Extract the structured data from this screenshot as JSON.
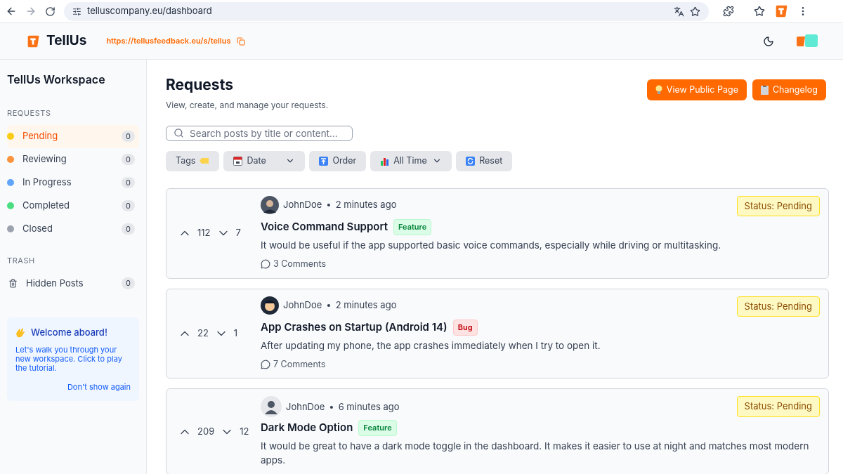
{
  "browser": {
    "url": "telluscompany.eu/dashboard"
  },
  "header": {
    "brand": "TellUs",
    "link": "https://tellusfeedback.eu/s/tellus"
  },
  "sidebar": {
    "title": "TellUs Workspace",
    "sections": [
      {
        "heading": "REQUESTS",
        "items": [
          {
            "label": "Pending",
            "count": "0",
            "color": "#facc15",
            "selected": true
          },
          {
            "label": "Reviewing",
            "count": "0",
            "color": "#fb923c",
            "selected": false
          },
          {
            "label": "In Progress",
            "count": "0",
            "color": "#60a5fa",
            "selected": false
          },
          {
            "label": "Completed",
            "count": "0",
            "color": "#4ade80",
            "selected": false
          },
          {
            "label": "Closed",
            "count": "0",
            "color": "#9ca3af",
            "selected": false
          }
        ]
      },
      {
        "heading": "TRASH",
        "items": [
          {
            "label": "Hidden Posts",
            "count": "0",
            "kind": "trash",
            "selected": false
          }
        ]
      }
    ],
    "welcome": {
      "title": "Welcome aboard!",
      "text": "Let's walk you through your new workspace. Click to play the tutorial.",
      "dismiss": "Don't show again"
    }
  },
  "page": {
    "title": "Requests",
    "subtitle": "View, create, and manage your requests.",
    "buttons": [
      {
        "label": "View Public Page",
        "kind": "bulb"
      },
      {
        "label": "Changelog",
        "kind": "clipboard"
      }
    ],
    "search": {
      "placeholder": "Search posts by title or content..."
    },
    "filters": [
      {
        "label": "Tags",
        "kind": "tag",
        "dropdown": false
      },
      {
        "label": "Date",
        "kind": "calendar",
        "dropdown": true
      },
      {
        "label": "Order",
        "kind": "order",
        "dropdown": false
      },
      {
        "label": "All Time",
        "kind": "chart",
        "dropdown": true
      },
      {
        "label": "Reset",
        "kind": "reset",
        "dropdown": false
      }
    ]
  },
  "posts": [
    {
      "author": "JohnDoe",
      "time": "2 minutes ago",
      "status": "Status: Pending",
      "title": "Voice Command Support",
      "tag": {
        "label": "Feature",
        "kind": "feature"
      },
      "body": "It would be useful if the app supported basic voice commands, especially while driving or multitasking.",
      "upvotes": "112",
      "downvotes": "7",
      "comments": "3 Comments",
      "separator": "•",
      "avatar": {
        "kind": "photo"
      }
    },
    {
      "author": "JohnDoe",
      "time": "2 minutes ago",
      "status": "Status: Pending",
      "title": "App Crashes on Startup (Android 14)",
      "tag": {
        "label": "Bug",
        "kind": "bug"
      },
      "body": "After updating my phone, the app crashes immediately when I try to open it.",
      "upvotes": "22",
      "downvotes": "1",
      "comments": "7 Comments",
      "separator": "•",
      "avatar": {
        "kind": "cartoon"
      }
    },
    {
      "author": "JohnDoe",
      "time": "6 minutes ago",
      "status": "Status: Pending",
      "title": "Dark Mode Option",
      "tag": {
        "label": "Feature",
        "kind": "feature"
      },
      "body": "It would be great to have a dark mode toggle in the dashboard. It makes it easier to use at night and matches most modern apps.",
      "upvotes": "209",
      "downvotes": "12",
      "separator": "•",
      "avatar": {
        "kind": "default"
      }
    }
  ]
}
